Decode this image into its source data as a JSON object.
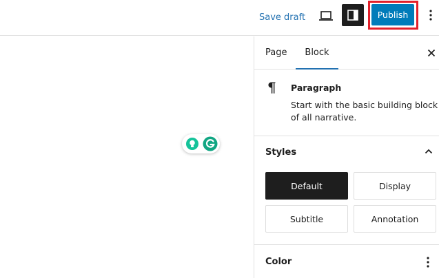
{
  "header": {
    "save_draft_label": "Save draft",
    "publish_label": "Publish",
    "accent_color": "#007cba",
    "highlight_color": "#e2202a"
  },
  "sidebar": {
    "tabs": [
      {
        "label": "Page",
        "active": false
      },
      {
        "label": "Block",
        "active": true
      }
    ],
    "block_card": {
      "title": "Paragraph",
      "description": "Start with the basic building block of all narrative.",
      "icon": "pilcrow-icon"
    },
    "styles": {
      "title": "Styles",
      "expanded": true,
      "options": [
        {
          "label": "Default",
          "active": true
        },
        {
          "label": "Display",
          "active": false
        },
        {
          "label": "Subtitle",
          "active": false
        },
        {
          "label": "Annotation",
          "active": false
        }
      ]
    },
    "color": {
      "title": "Color"
    }
  },
  "icons": {
    "preview": "laptop-icon",
    "settings": "sidebar-toggle-icon",
    "more": "vertical-ellipsis-icon",
    "close": "close-icon",
    "chevron": "chevron-up-icon",
    "grammarly": "grammarly-icon",
    "bulb": "lightbulb-icon"
  }
}
